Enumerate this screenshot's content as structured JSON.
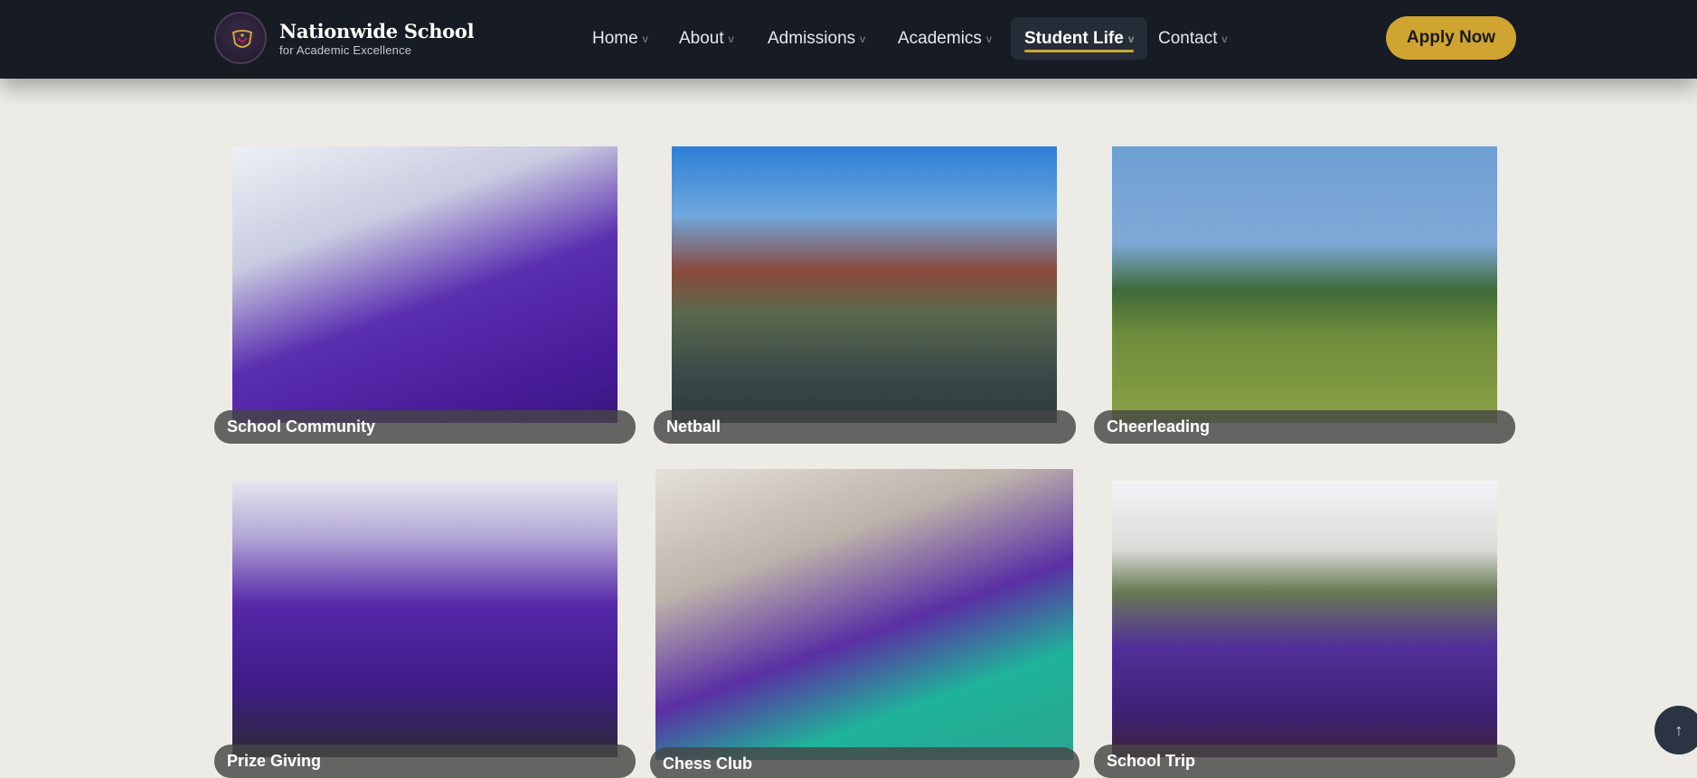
{
  "header": {
    "brand_name": "Nationwide School",
    "brand_sub": "for Academic Excellence",
    "logo_icon": "school-crest-icon",
    "nav": [
      {
        "label": "Home",
        "active": false
      },
      {
        "label": "About",
        "active": false
      },
      {
        "label": "Admissions",
        "active": false
      },
      {
        "label": "Academics",
        "active": false
      },
      {
        "label": "Student Life",
        "active": true
      },
      {
        "label": "Contact",
        "active": false
      }
    ],
    "chevron": "v",
    "apply_label": "Apply Now"
  },
  "gallery": [
    {
      "caption": "School Community"
    },
    {
      "caption": "Netball"
    },
    {
      "caption": "Cheerleading"
    },
    {
      "caption": "Prize Giving"
    },
    {
      "caption": "Chess Club"
    },
    {
      "caption": "School Trip"
    }
  ],
  "scroll_top_icon": "arrow-up-icon",
  "colors": {
    "header_bg": "#161b24",
    "accent": "#d0a431",
    "page_bg": "#ecebe6",
    "brand_purple": "#4a1d9c"
  }
}
